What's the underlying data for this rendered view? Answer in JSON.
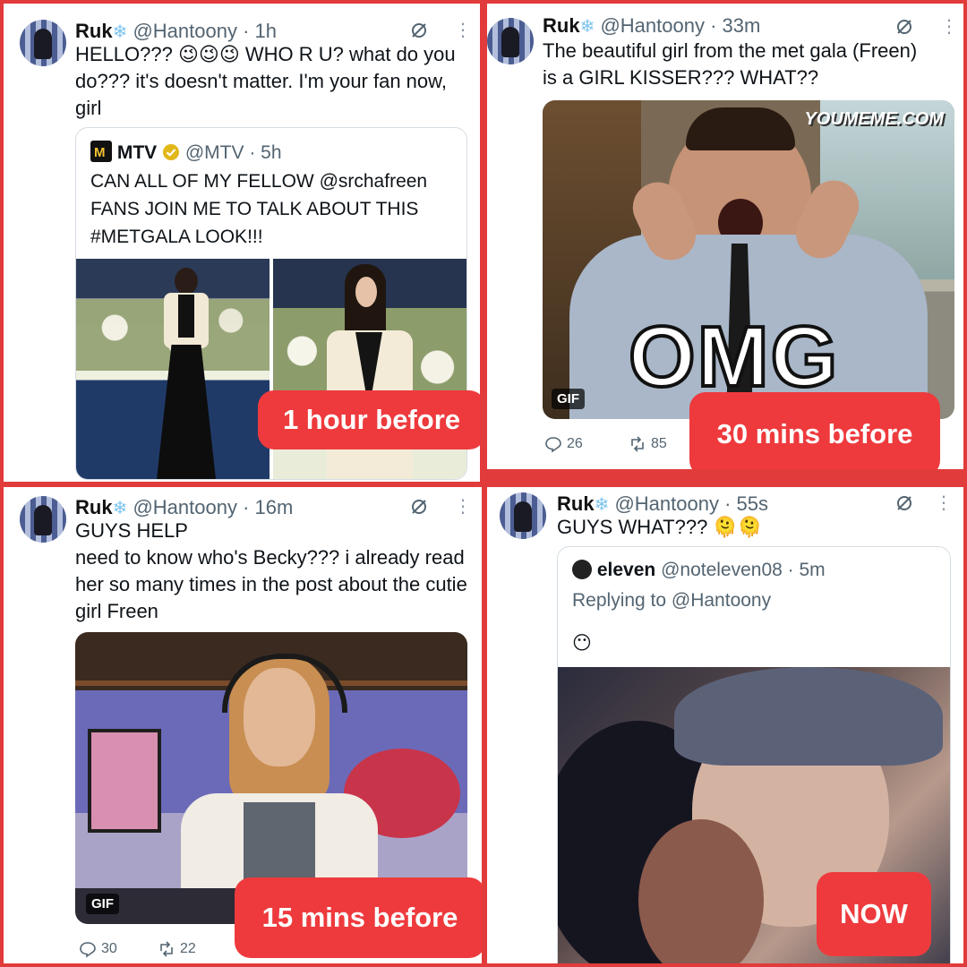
{
  "panels": [
    {
      "author": {
        "name": "Ruk",
        "handle": "@Hantoony",
        "time": "· 1h"
      },
      "text": "HELLO??? 😉😉😉 WHO R U? what do you do??? it's doesn't matter. I'm your fan now, girl",
      "quote": {
        "name": "MTV",
        "handle": "@MTV · 5h",
        "text": "CAN ALL OF MY FELLOW @srchafreen FANS JOIN ME TO TALK ABOUT THIS #METGALA LOOK!!!"
      },
      "time_label": "1 hour before"
    },
    {
      "author": {
        "name": "Ruk",
        "handle": "@Hantoony",
        "time": "· 33m"
      },
      "text": "The beautiful girl from the met gala (Freen) is a GIRL KISSER??? WHAT??",
      "gif_watermark": "YOUMEME.COM",
      "gif_caption": "OMG",
      "gif_badge": "GIF",
      "stats": {
        "replies": "26",
        "reposts": "85"
      },
      "time_label": "30 mins before"
    },
    {
      "author": {
        "name": "Ruk",
        "handle": "@Hantoony",
        "time": "· 16m"
      },
      "text_line1": "GUYS HELP",
      "text": "need to know who's Becky??? i already read her so many times in the post about the cutie girl Freen",
      "gif_badge": "GIF",
      "stats": {
        "replies": "30",
        "reposts": "22"
      },
      "time_label": "15 mins before"
    },
    {
      "author": {
        "name": "Ruk",
        "handle": "@Hantoony",
        "time": "· 55s"
      },
      "text": "GUYS WHAT??? 🫠🫠",
      "quote": {
        "name": "eleven",
        "handle": "@noteleven08 · 5m",
        "reply_to": "Replying to @Hantoony",
        "text": "😶"
      },
      "time_label": "NOW"
    }
  ],
  "colors": {
    "frame": "#e23b3b",
    "label_bg": "#ee3a3d",
    "muted": "#536471",
    "verified": "#e2b719"
  },
  "icons": [
    "grok-icon",
    "more-icon",
    "reply-icon",
    "repost-icon",
    "verified-icon",
    "snowflake-icon"
  ]
}
